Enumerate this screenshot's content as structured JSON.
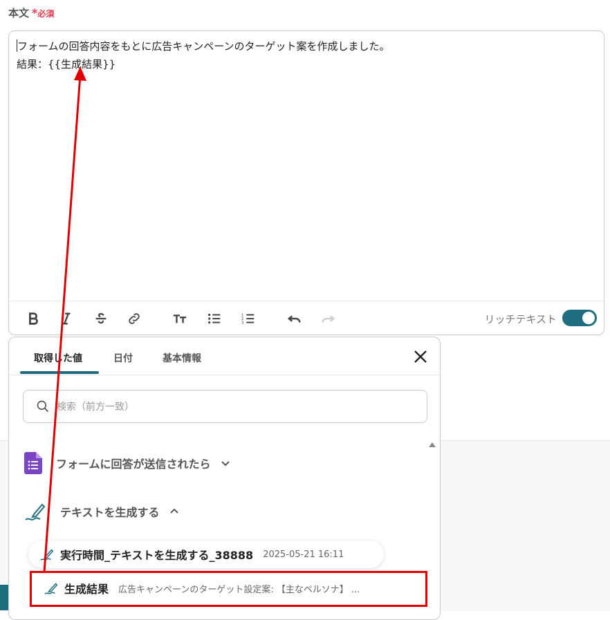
{
  "field": {
    "label": "本文",
    "required_mark": "*",
    "required_text": "必須"
  },
  "editor": {
    "line1": "フォームの回答内容をもとに広告キャンペーンのターゲット案を作成しました。",
    "line2": "結果：{{生成結果}}",
    "toolbar": {
      "bold": "bold-icon",
      "italic": "italic-icon",
      "strike": "strikethrough-icon",
      "link": "link-icon",
      "text_size": "text-size-icon",
      "bullet_list": "bullet-list-icon",
      "numbered_list": "numbered-list-icon",
      "undo": "undo-icon",
      "redo": "redo-icon"
    },
    "rich_text_label": "リッチテキスト",
    "rich_text_enabled": true
  },
  "popover": {
    "tabs": [
      {
        "label": "取得した値",
        "active": true
      },
      {
        "label": "日付",
        "active": false
      },
      {
        "label": "基本情報",
        "active": false
      }
    ],
    "search_placeholder": "検索（前方一致）",
    "groups": [
      {
        "label": "フォームに回答が送信されたら",
        "icon": "google-forms-icon",
        "expanded": false
      },
      {
        "label": "テキストを生成する",
        "icon": "ai-pen-icon",
        "expanded": true
      }
    ],
    "items": [
      {
        "name": "実行時間_テキストを生成する_38888",
        "value": "2025-05-21 16:11"
      },
      {
        "name": "生成結果",
        "value": "広告キャンペーンのターゲット設定案: 【主なペルソナ】 ..."
      }
    ]
  },
  "colors": {
    "accent": "#1f6e80",
    "required": "#e53950",
    "annotation": "#e00000",
    "forms_purple": "#7b44c7"
  }
}
